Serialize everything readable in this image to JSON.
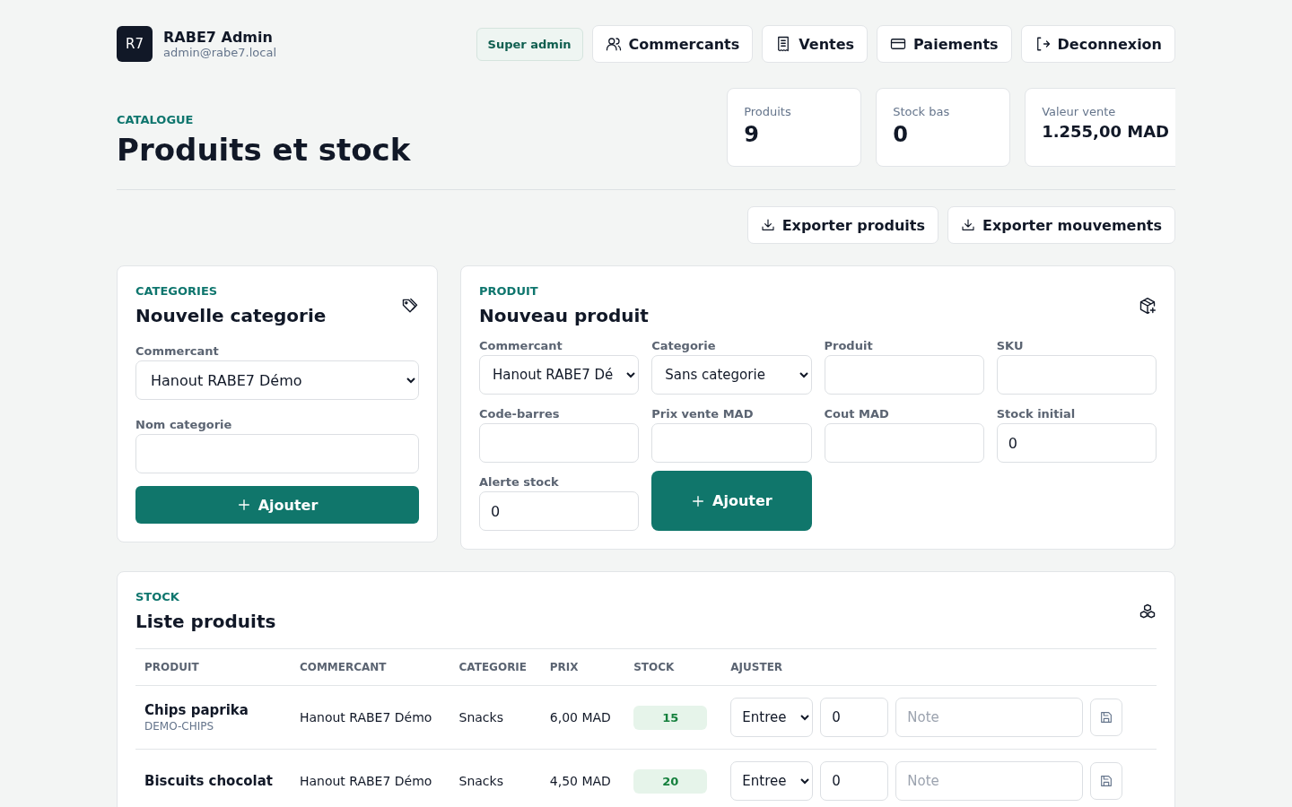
{
  "brand": {
    "logo": "R7",
    "name": "RABE7 Admin",
    "email": "admin@rabe7.local"
  },
  "role_badge": "Super admin",
  "nav": [
    {
      "label": "Commercants"
    },
    {
      "label": "Ventes"
    },
    {
      "label": "Paiements"
    },
    {
      "label": "Deconnexion"
    }
  ],
  "page": {
    "eyebrow": "CATALOGUE",
    "title": "Produits et stock"
  },
  "stats": [
    {
      "label": "Produits",
      "value": "9"
    },
    {
      "label": "Stock bas",
      "value": "0"
    },
    {
      "label": "Valeur vente",
      "value": "1.255,00 MAD"
    }
  ],
  "exports": [
    "Exporter produits",
    "Exporter mouvements"
  ],
  "category_form": {
    "eyebrow": "CATEGORIES",
    "title": "Nouvelle categorie",
    "merchant_label": "Commercant",
    "merchant_value": "Hanout RABE7 Démo",
    "name_label": "Nom categorie",
    "submit": "Ajouter"
  },
  "product_form": {
    "eyebrow": "PRODUIT",
    "title": "Nouveau produit",
    "submit": "Ajouter",
    "fields": [
      {
        "label": "Commercant",
        "kind": "select",
        "value": "Hanout RABE7 Dé"
      },
      {
        "label": "Categorie",
        "kind": "select",
        "value": "Sans categorie"
      },
      {
        "label": "Produit",
        "kind": "input"
      },
      {
        "label": "SKU",
        "kind": "input"
      },
      {
        "label": "Code-barres",
        "kind": "input"
      },
      {
        "label": "Prix vente MAD",
        "kind": "input"
      },
      {
        "label": "Cout MAD",
        "kind": "input"
      },
      {
        "label": "Stock initial",
        "kind": "input",
        "value": "0"
      },
      {
        "label": "Alerte stock",
        "kind": "input",
        "value": "0"
      }
    ]
  },
  "stock": {
    "eyebrow": "STOCK",
    "title": "Liste produits",
    "columns": [
      "PRODUIT",
      "COMMERCANT",
      "CATEGORIE",
      "PRIX",
      "STOCK",
      "AJUSTER"
    ],
    "rows": [
      {
        "name": "Chips paprika",
        "sku": "DEMO-CHIPS",
        "merchant": "Hanout RABE7 Démo",
        "category": "Snacks",
        "price": "6,00 MAD",
        "stock": "15",
        "movement": "Entree",
        "quantity": "0",
        "note_placeholder": "Note"
      },
      {
        "name": "Biscuits chocolat",
        "merchant": "Hanout RABE7 Démo",
        "category": "Snacks",
        "price": "4,50 MAD",
        "stock": "20",
        "movement": "Entree",
        "quantity": "0",
        "note_placeholder": "Note"
      }
    ]
  }
}
